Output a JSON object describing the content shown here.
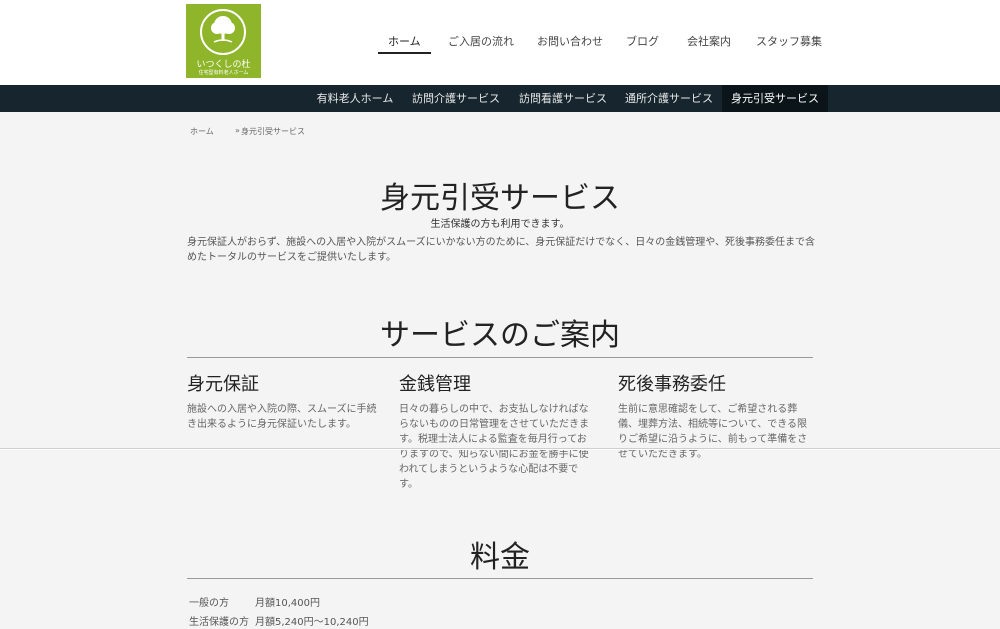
{
  "logo": {
    "name": "いつくしの杜",
    "sub": "住宅型有料老人ホーム"
  },
  "main_nav": [
    {
      "label": "ホーム",
      "active": true
    },
    {
      "label": "ご入居の流れ"
    },
    {
      "label": "お問い合わせ"
    },
    {
      "label": "ブログ"
    },
    {
      "label": "会社案内"
    },
    {
      "label": "スタッフ募集"
    }
  ],
  "sub_nav": [
    {
      "label": "有料老人ホーム"
    },
    {
      "label": "訪問介護サービス"
    },
    {
      "label": "訪問看護サービス"
    },
    {
      "label": "通所介護サービス"
    },
    {
      "label": "身元引受サービス",
      "active": true
    }
  ],
  "breadcrumb": {
    "home": "ホーム",
    "separator": "»",
    "current": "身元引受サービス"
  },
  "page": {
    "title": "身元引受サービス",
    "subtitle": "生活保護の方も利用できます。",
    "intro": "身元保証人がおらず、施設への入居や入院がスムーズにいかない方のために、身元保証だけでなく、日々の金銭管理や、死後事務委任まで含めたトータルのサービスをご提供いたします。"
  },
  "services_section": {
    "title": "サービスのご案内",
    "items": [
      {
        "title": "身元保証",
        "text": "施設への入居や入院の際、スムーズに手続き出来るように身元保証いたします。"
      },
      {
        "title": "金銭管理",
        "text": "日々の暮らしの中で、お支払しなければならないものの日常管理をさせていただきます。税理士法人による監査を毎月行っておりますので、知らない間にお金を勝手に使われてしまうというような心配は不要です。"
      },
      {
        "title": "死後事務委任",
        "text": "生前に意思確認をして、ご希望される葬儀、埋葬方法、相続等について、できる限りご希望に沿うように、前もって準備をさせていただきます。"
      }
    ]
  },
  "price_section": {
    "title": "料金",
    "rows": [
      {
        "label": "一般の方",
        "value": "月額10,400円"
      },
      {
        "label": "生活保護の方",
        "value": "月額5,240円～10,240円"
      }
    ]
  },
  "colors": {
    "logo_green": "#8fb52b",
    "subnav_bg": "#17262e",
    "subnav_active": "#0b1419"
  }
}
